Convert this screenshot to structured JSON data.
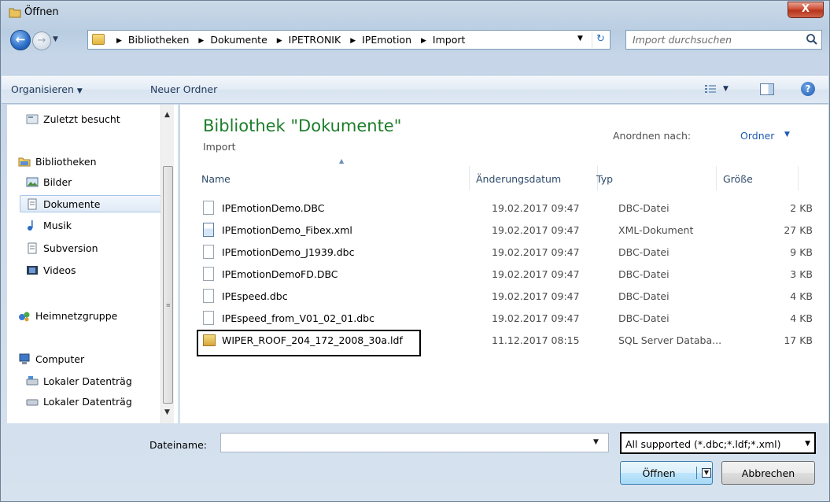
{
  "window": {
    "title": "Öffnen",
    "close_label": "X"
  },
  "nav": {
    "crumbs": [
      "Bibliotheken",
      "Dokumente",
      "IPETRONIK",
      "IPEmotion",
      "Import"
    ],
    "search_placeholder": "Import durchsuchen"
  },
  "toolbar": {
    "organize_label": "Organisieren",
    "new_folder_label": "Neuer Ordner"
  },
  "sidebar": {
    "items": [
      {
        "label": "Zuletzt besucht",
        "icon": "recent-places-icon"
      },
      {
        "label": "Bibliotheken",
        "icon": "libraries-icon"
      },
      {
        "label": "Bilder",
        "icon": "pictures-icon"
      },
      {
        "label": "Dokumente",
        "icon": "documents-icon",
        "selected": true
      },
      {
        "label": "Musik",
        "icon": "music-icon"
      },
      {
        "label": "Subversion",
        "icon": "subversion-icon"
      },
      {
        "label": "Videos",
        "icon": "videos-icon"
      },
      {
        "label": "Heimnetzgruppe",
        "icon": "homegroup-icon"
      },
      {
        "label": "Computer",
        "icon": "computer-icon"
      },
      {
        "label": "Lokaler Datenträg",
        "icon": "local-disk-icon"
      },
      {
        "label": "Lokaler Datenträg",
        "icon": "local-disk-icon"
      }
    ]
  },
  "content": {
    "library_title": "Bibliothek \"Dokumente\"",
    "library_subtitle": "Import",
    "arrange_label": "Anordnen nach:",
    "arrange_value": "Ordner",
    "columns": [
      "Name",
      "Änderungsdatum",
      "Typ",
      "Größe"
    ],
    "files": [
      {
        "name": "IPEmotionDemo.DBC",
        "date": "19.02.2017 09:47",
        "type": "DBC-Datei",
        "size": "2 KB",
        "icon": "file-icon"
      },
      {
        "name": "IPEmotionDemo_Fibex.xml",
        "date": "19.02.2017 09:47",
        "type": "XML-Dokument",
        "size": "27 KB",
        "icon": "xml-file-icon"
      },
      {
        "name": "IPEmotionDemo_J1939.dbc",
        "date": "19.02.2017 09:47",
        "type": "DBC-Datei",
        "size": "9 KB",
        "icon": "file-icon"
      },
      {
        "name": "IPEmotionDemoFD.DBC",
        "date": "19.02.2017 09:47",
        "type": "DBC-Datei",
        "size": "3 KB",
        "icon": "file-icon"
      },
      {
        "name": "IPEspeed.dbc",
        "date": "19.02.2017 09:47",
        "type": "DBC-Datei",
        "size": "4 KB",
        "icon": "file-icon"
      },
      {
        "name": "IPEspeed_from_V01_02_01.dbc",
        "date": "19.02.2017 09:47",
        "type": "DBC-Datei",
        "size": "4 KB",
        "icon": "file-icon"
      },
      {
        "name": "WIPER_ROOF_204_172_2008_30a.ldf",
        "date": "11.12.2017 08:15",
        "type": "SQL Server Databa...",
        "size": "17 KB",
        "icon": "ldf-file-icon"
      }
    ]
  },
  "bottom": {
    "filename_label": "Dateiname:",
    "filename_value": "",
    "filter_value": "All supported (*.dbc;*.ldf;*.xml)",
    "open_label": "Öffnen",
    "cancel_label": "Abbrechen"
  }
}
